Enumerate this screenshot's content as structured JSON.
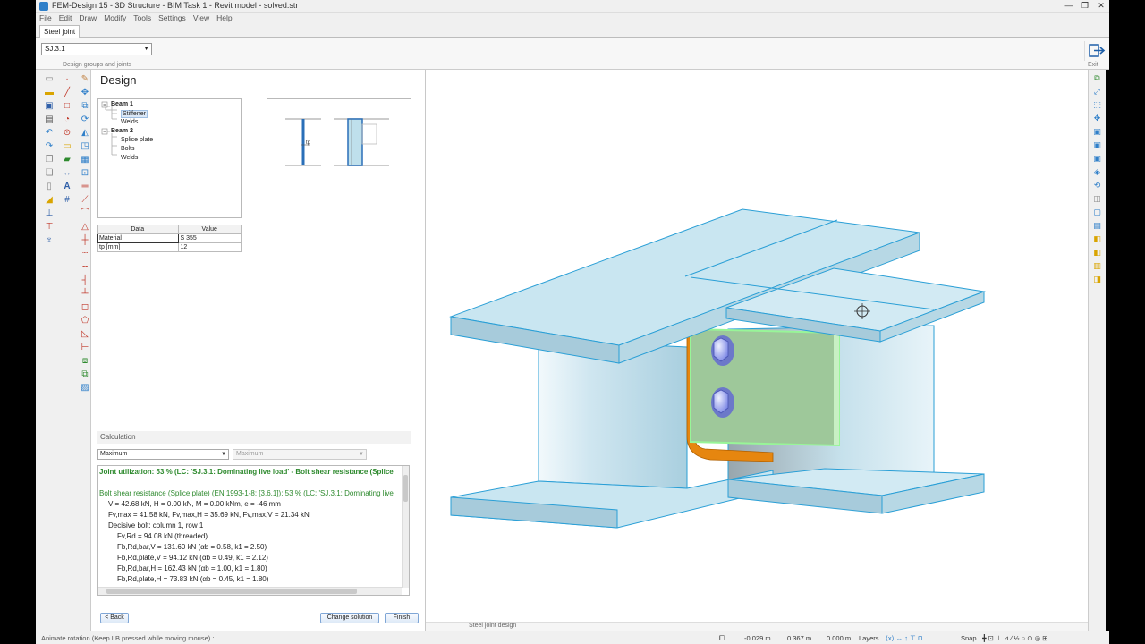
{
  "window": {
    "title": "FEM-Design 15 - 3D Structure - BIM Task 1 - Revit model - solved.str",
    "controls": [
      "—",
      "❐",
      "✕"
    ]
  },
  "menu": [
    "File",
    "Edit",
    "Draw",
    "Modify",
    "Tools",
    "Settings",
    "View",
    "Help"
  ],
  "ribbon": {
    "tab": "Steel joint",
    "joint_select": "SJ.3.1",
    "group_label": "Design groups and joints",
    "exit_label": "Exit"
  },
  "design": {
    "title": "Design",
    "tree": [
      {
        "label": "Beam 1",
        "level": 0
      },
      {
        "label": "Stiffener",
        "level": 1,
        "selected": true
      },
      {
        "label": "Welds",
        "level": 1
      },
      {
        "label": "Beam 2",
        "level": 0
      },
      {
        "label": "Splice plate",
        "level": 1
      },
      {
        "label": "Bolts",
        "level": 1
      },
      {
        "label": "Welds",
        "level": 1
      }
    ],
    "preview_label": "tp",
    "table": {
      "headers": [
        "Data",
        "Value"
      ],
      "rows": [
        [
          "Material",
          "S 355"
        ],
        [
          "tp [mm]",
          "12"
        ]
      ]
    },
    "calculation": {
      "header": "Calculation",
      "dropdown1": "Maximum",
      "dropdown2": "Maximum"
    },
    "results": [
      "Joint utilization: 53 % (LC: 'SJ.3.1: Dominating live load' - Bolt shear resistance (Splice",
      "Bolt shear resistance (Splice plate) (EN 1993-1-8: [3.6.1]): 53 % (LC: 'SJ.3.1: Dominating live",
      "V = 42.68 kN, H = 0.00 kN, M = 0.00 kNm, e = -46 mm",
      "Fv,max = 41.58 kN, Fv,max,H = 35.69 kN, Fv,max,V = 21.34 kN",
      "Decisive bolt: column 1, row 1",
      "Fv,Rd = 94.08 kN (threaded)",
      "Fb,Rd,bar,V = 131.60 kN (αb = 0.58, k1 = 2.50)",
      "Fb,Rd,plate,V = 94.12 kN (αb = 0.49, k1 = 2.12)",
      "Fb,Rd,bar,H = 162.43 kN (αb = 1.00, k1 = 1.80)",
      "Fb,Rd,plate,H = 73.83 kN (αb = 0.45, k1 = 1.80)"
    ],
    "buttons": {
      "back": "< Back",
      "change": "Change solution",
      "finish": "Finish"
    }
  },
  "viewport": {
    "tab": "Steel joint design"
  },
  "status": {
    "hint": "Animate rotation (Keep LB pressed while moving mouse) :",
    "x": "-0.029 m",
    "y": "0.367 m",
    "z": "0.000 m",
    "layers": "Layers",
    "snap": "Snap"
  },
  "colors": {
    "steel": "#bfe0ec",
    "edge": "#2a9fd6",
    "plate": "#9ec89a",
    "plate_edge": "#98f598",
    "stiffener_side": "#e6860f",
    "bolt": "#9da8f0",
    "result_green": "#2e8a2e"
  }
}
